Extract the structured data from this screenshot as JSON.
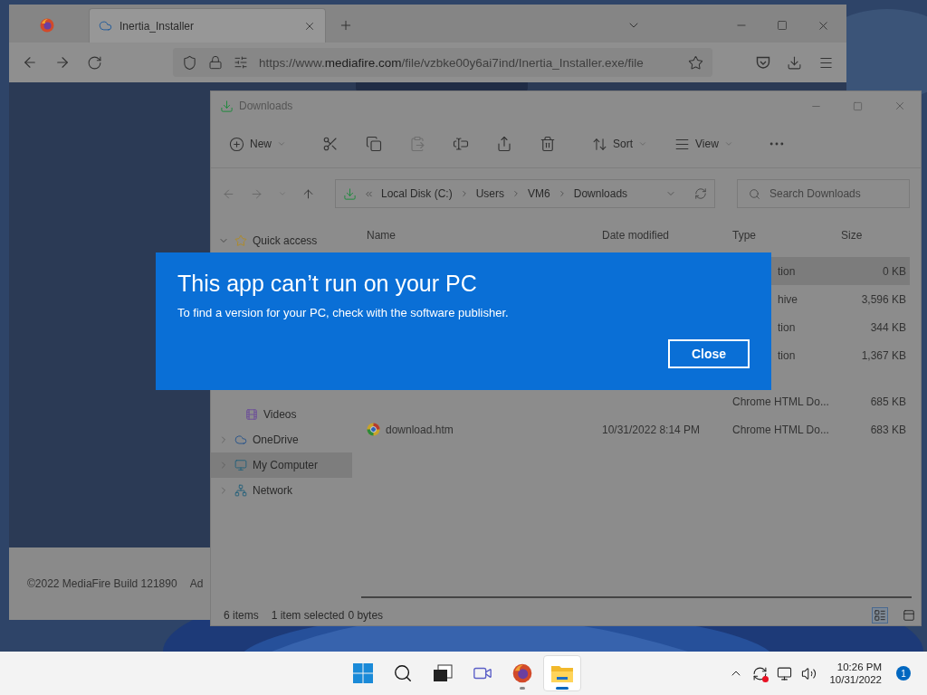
{
  "browser": {
    "tabs": [
      {
        "kind": "pinned",
        "selected": false
      },
      {
        "kind": "page",
        "label": "Inertia_Installer",
        "selected": true
      }
    ],
    "url": [
      "https://www.",
      "mediafire.com",
      "/file/vzbke00y6ai7ind/Inertia_Installer.exe/file"
    ],
    "footer": [
      "©2022 MediaFire Build 121890",
      "Ad"
    ]
  },
  "explorer": {
    "title": "Downloads",
    "toolbar": {
      "new_label": "New",
      "sort_label": "Sort",
      "view_label": "View",
      "paste": {
        "disabled": true
      }
    },
    "breadcrumb": [
      "Local Disk (C:)",
      "Users",
      "VM6",
      "Downloads"
    ],
    "search": {
      "placeholder": "Search Downloads"
    },
    "columns": [
      "Name",
      "Date modified",
      "Type",
      "Size"
    ],
    "nav": [
      {
        "kind": "star",
        "label": "Quick access",
        "expanded": true,
        "selected": false,
        "children": [
          {
            "kind": "videos",
            "label": "Videos",
            "selected": false
          }
        ]
      },
      {
        "kind": "cloud",
        "label": "OneDrive",
        "expanded": false,
        "selected": false
      },
      {
        "kind": "computer",
        "label": "My Computer",
        "expanded": false,
        "selected": true
      },
      {
        "kind": "network",
        "label": "Network",
        "expanded": false,
        "selected": false
      }
    ],
    "rows": [
      {
        "kind": "fragment",
        "type": "tion",
        "size": "0 KB",
        "selected": true
      },
      {
        "kind": "fragment",
        "type": "hive",
        "size": "3,596 KB",
        "selected": false
      },
      {
        "kind": "fragment",
        "type": "tion",
        "size": "344 KB",
        "selected": false
      },
      {
        "kind": "fragment",
        "type": "tion",
        "size": "1,367 KB",
        "selected": false
      },
      {
        "kind": "plain",
        "type": "Chrome HTML Do...",
        "size": "685 KB",
        "selected": false
      },
      {
        "kind": "plain",
        "name": "download.htm",
        "date": "10/31/2022 8:14 PM",
        "type": "Chrome HTML Do...",
        "size": "683 KB",
        "selected": false
      }
    ],
    "status": [
      "6 items",
      "1 item selected",
      "0 bytes"
    ],
    "view_modes": [
      {
        "kind": "details",
        "selected": true
      },
      {
        "kind": "tiles",
        "selected": false
      }
    ]
  },
  "dialog": {
    "title": "This app can’t run on your PC",
    "message": "To find a version for your PC, check with the software publisher.",
    "button": "Close"
  },
  "taskbar": {
    "apps": [
      {
        "kind": "start",
        "running": false,
        "active": false
      },
      {
        "kind": "search",
        "running": false,
        "active": false
      },
      {
        "kind": "taskview",
        "running": false,
        "active": false
      },
      {
        "kind": "chat",
        "running": false,
        "active": false
      },
      {
        "kind": "firefox",
        "running": true,
        "active": false
      },
      {
        "kind": "explorer",
        "running": true,
        "active": true
      }
    ],
    "time": "10:26 PM",
    "date": "10/31/2022",
    "badge": "1"
  }
}
